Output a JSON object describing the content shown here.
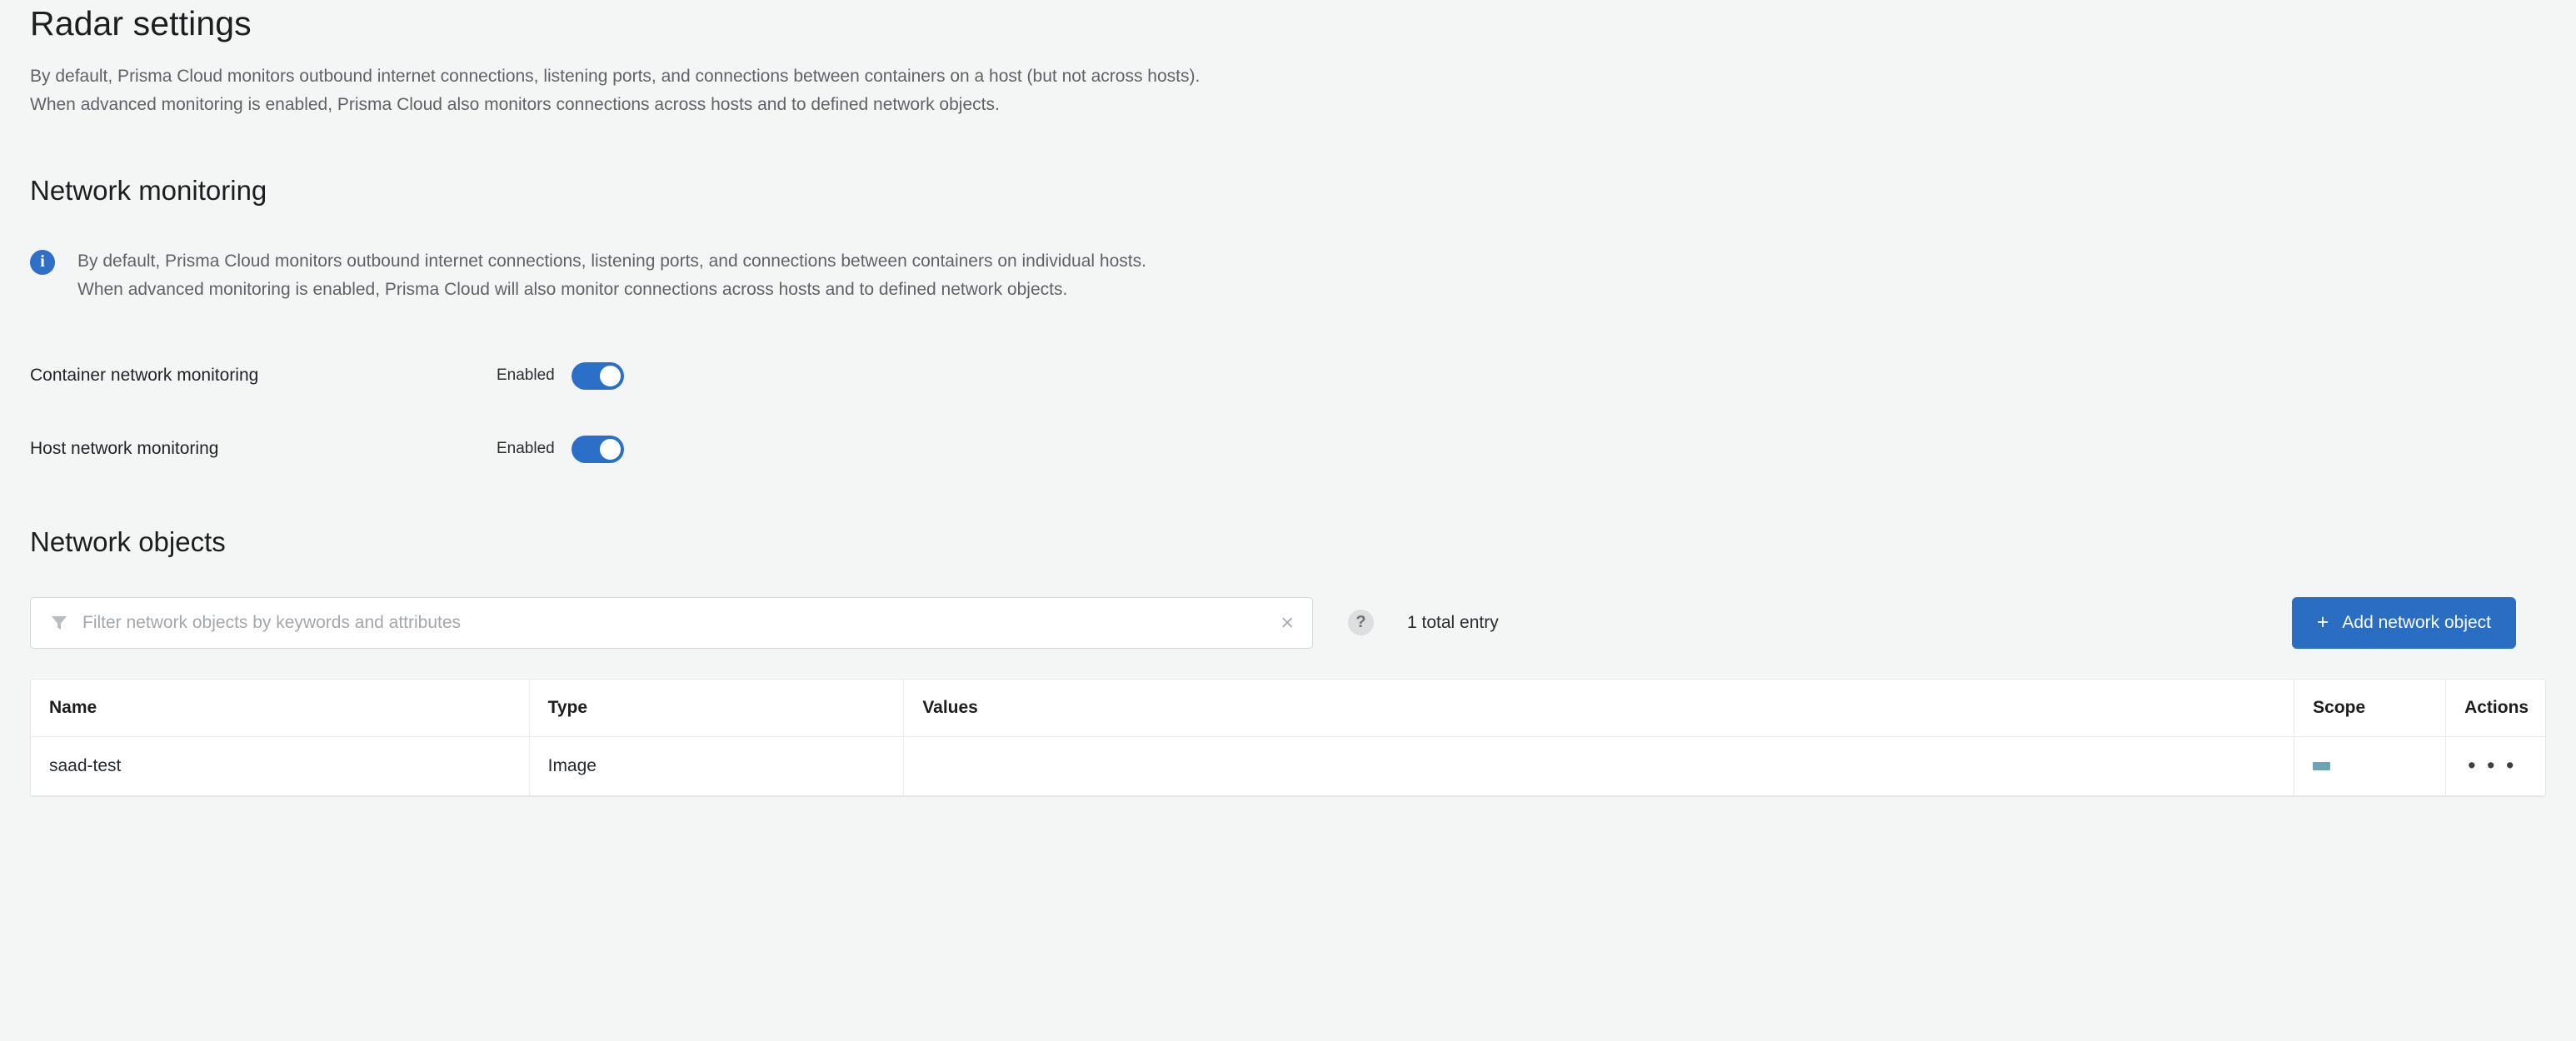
{
  "page": {
    "title": "Radar settings",
    "description_lines": [
      "By default, Prisma Cloud monitors outbound internet connections, listening ports, and connections between containers on a host (but not across hosts).",
      "When advanced monitoring is enabled, Prisma Cloud also monitors connections across hosts and to defined network objects."
    ]
  },
  "network_monitoring": {
    "title": "Network monitoring",
    "info_icon": "info-icon",
    "info_lines": [
      "By default, Prisma Cloud monitors outbound internet connections, listening ports, and connections between containers on individual hosts.",
      "When advanced monitoring is enabled, Prisma Cloud will also monitor connections across hosts and to defined network objects."
    ],
    "toggles": [
      {
        "label": "Container network monitoring",
        "state": "Enabled",
        "on": true
      },
      {
        "label": "Host network monitoring",
        "state": "Enabled",
        "on": true
      }
    ]
  },
  "network_objects": {
    "title": "Network objects",
    "filter": {
      "icon": "funnel-icon",
      "placeholder": "Filter network objects by keywords and attributes",
      "value": "",
      "clear_icon": "×"
    },
    "help_badge": "?",
    "total_entry": "1 total entry",
    "add_button": {
      "plus": "+",
      "label": "Add network object"
    },
    "table": {
      "columns": [
        "Name",
        "Type",
        "Values",
        "Scope",
        "Actions"
      ],
      "rows": [
        {
          "name": "saad-test",
          "type": "Image",
          "values": "",
          "scope_chip": true,
          "actions_icon": "• • •"
        }
      ]
    }
  },
  "colors": {
    "accent_blue": "#2a6ec4",
    "toggle_blue": "#2b6fc9",
    "info_blue": "#2f6fc7",
    "scope_chip": "#6ba4b3",
    "page_bg": "#f4f5f5",
    "surface": "#ffffff",
    "muted_text": "#5f6368"
  }
}
